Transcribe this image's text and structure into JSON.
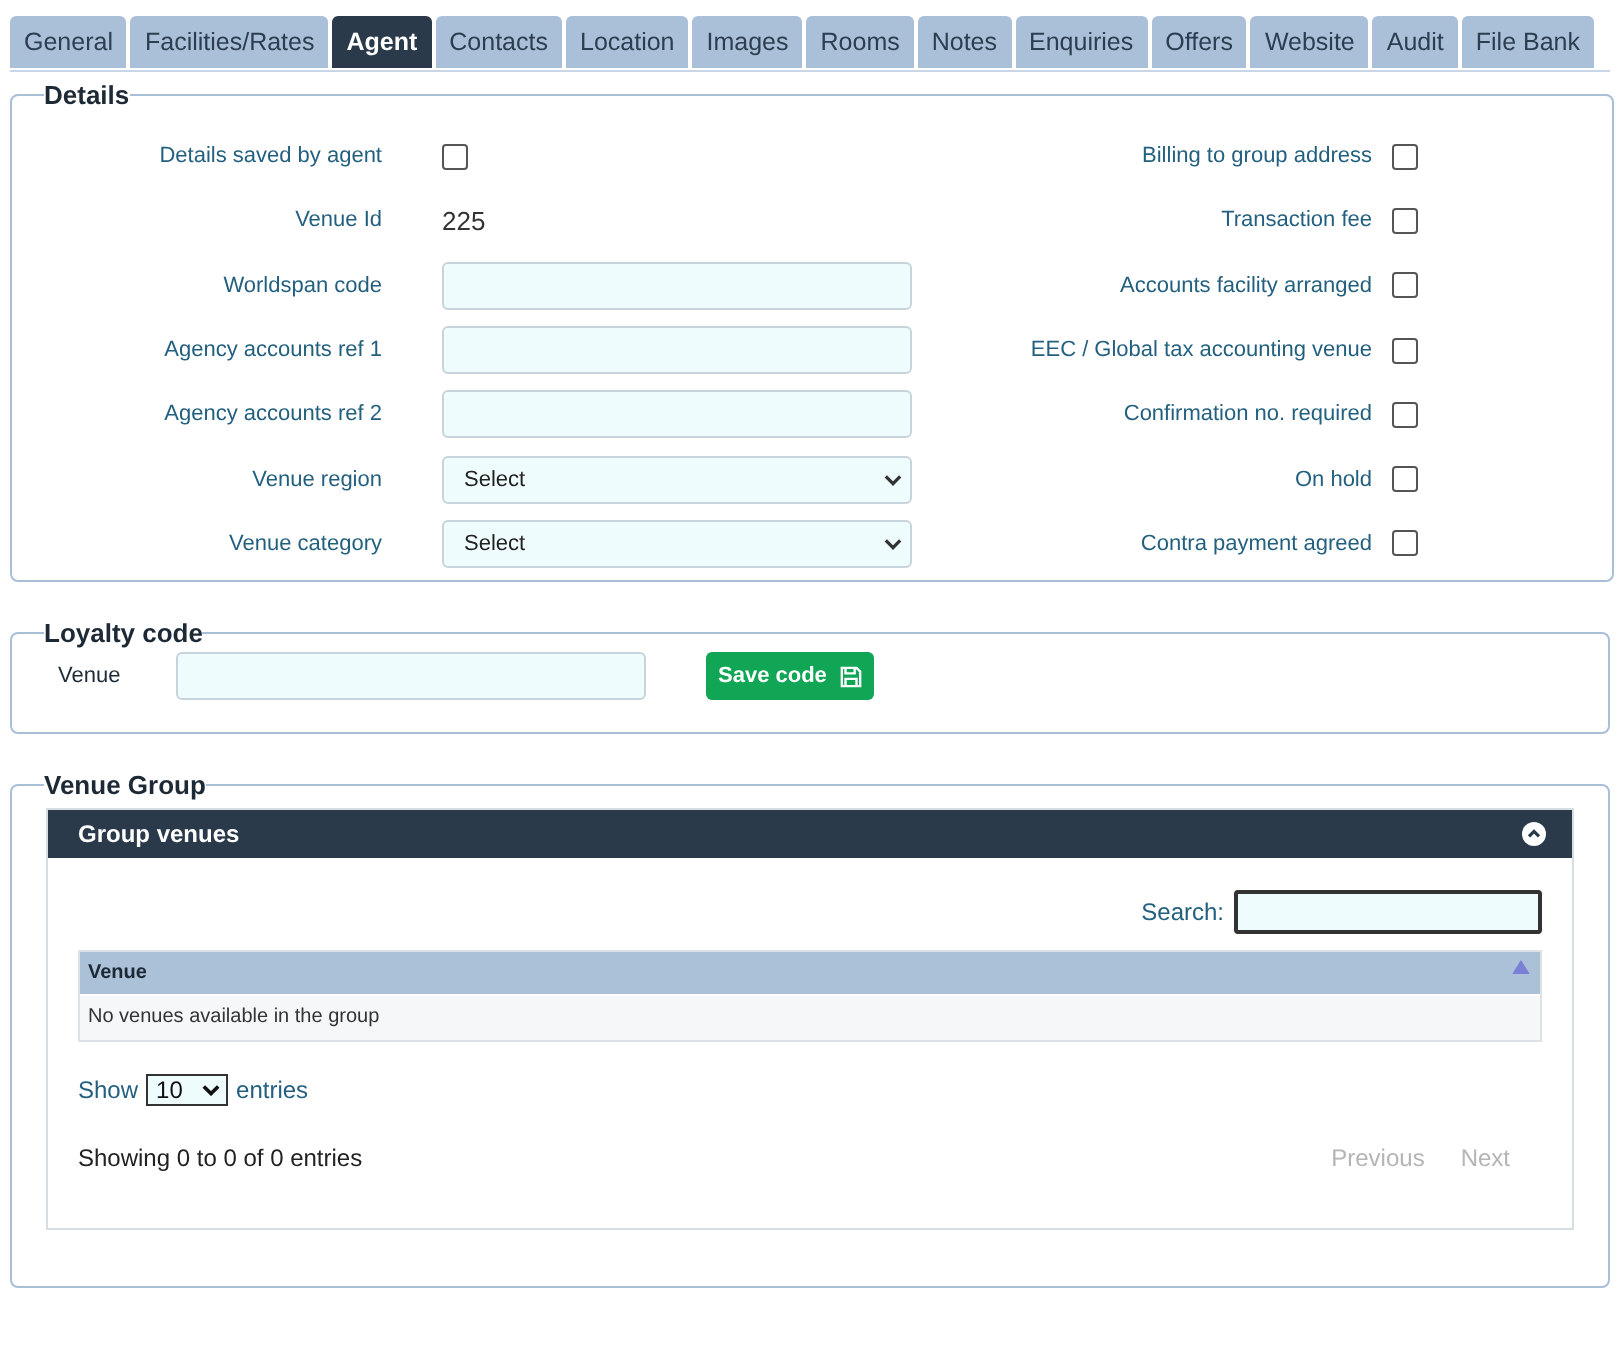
{
  "tabs": [
    {
      "label": "General",
      "selected": false
    },
    {
      "label": "Facilities/Rates",
      "selected": false
    },
    {
      "label": "Agent",
      "selected": true
    },
    {
      "label": "Contacts",
      "selected": false
    },
    {
      "label": "Location",
      "selected": false
    },
    {
      "label": "Images",
      "selected": false
    },
    {
      "label": "Rooms",
      "selected": false
    },
    {
      "label": "Notes",
      "selected": false
    },
    {
      "label": "Enquiries",
      "selected": false
    },
    {
      "label": "Offers",
      "selected": false
    },
    {
      "label": "Website",
      "selected": false
    },
    {
      "label": "Audit",
      "selected": false
    },
    {
      "label": "File Bank",
      "selected": false
    }
  ],
  "details": {
    "legend": "Details",
    "left": [
      {
        "kind": "checkbox",
        "label": "Details saved by agent",
        "checked": false
      },
      {
        "kind": "text",
        "label": "Venue Id",
        "value": "225"
      },
      {
        "kind": "input",
        "label": "Worldspan code"
      },
      {
        "kind": "input",
        "label": "Agency accounts ref 1"
      },
      {
        "kind": "input",
        "label": "Agency accounts ref 2"
      },
      {
        "kind": "select",
        "label": "Venue region",
        "value": "Select"
      },
      {
        "kind": "select",
        "label": "Venue category",
        "value": "Select"
      }
    ],
    "right": [
      {
        "label": "Billing to group address",
        "checked": false
      },
      {
        "label": "Transaction fee",
        "checked": false
      },
      {
        "label": "Accounts facility arranged",
        "checked": false
      },
      {
        "label": "EEC / Global tax accounting venue",
        "checked": false
      },
      {
        "label": "Confirmation no. required",
        "checked": false
      },
      {
        "label": "On hold",
        "checked": false
      },
      {
        "label": "Contra payment agreed",
        "checked": false
      }
    ]
  },
  "loyalty": {
    "legend": "Loyalty code",
    "label": "Venue",
    "button": "Save code"
  },
  "venue_group": {
    "legend": "Venue Group",
    "panel_title": "Group venues",
    "expanded": true,
    "search_label": "Search:",
    "table": {
      "columns": [
        "Venue"
      ],
      "empty_message": "No venues available in the group"
    },
    "show_label": "Show",
    "page_size": "10",
    "entries_label": "entries",
    "info": "Showing 0 to 0 of 0 entries",
    "pagination": [
      {
        "label": "Previous",
        "disabled": true
      },
      {
        "label": "Next",
        "disabled": true
      }
    ]
  }
}
